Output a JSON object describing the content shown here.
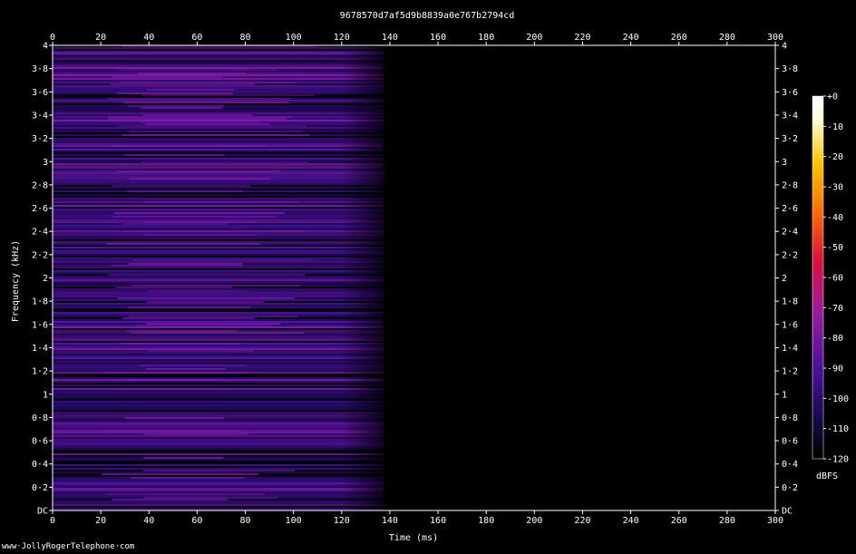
{
  "chart_data": {
    "type": "heatmap",
    "title": "9678570d7af5d9b8839a0e767b2794cd",
    "xlabel": "Time (ms)",
    "ylabel": "Frequency (kHz)",
    "xlim": [
      0,
      300
    ],
    "ylim": [
      0,
      4
    ],
    "x_ticks": [
      0,
      20,
      40,
      60,
      80,
      100,
      120,
      140,
      160,
      180,
      200,
      220,
      240,
      260,
      280,
      300
    ],
    "y_ticks": [
      {
        "value": 0,
        "label": "DC"
      },
      {
        "value": 0.2,
        "label": "0·2"
      },
      {
        "value": 0.4,
        "label": "0·4"
      },
      {
        "value": 0.6,
        "label": "0·6"
      },
      {
        "value": 0.8,
        "label": "0·8"
      },
      {
        "value": 1.0,
        "label": "1"
      },
      {
        "value": 1.2,
        "label": "1·2"
      },
      {
        "value": 1.4,
        "label": "1·4"
      },
      {
        "value": 1.6,
        "label": "1·6"
      },
      {
        "value": 1.8,
        "label": "1·8"
      },
      {
        "value": 2.0,
        "label": "2"
      },
      {
        "value": 2.2,
        "label": "2·2"
      },
      {
        "value": 2.4,
        "label": "2·4"
      },
      {
        "value": 2.6,
        "label": "2·6"
      },
      {
        "value": 2.8,
        "label": "2·8"
      },
      {
        "value": 3.0,
        "label": "3"
      },
      {
        "value": 3.2,
        "label": "3·2"
      },
      {
        "value": 3.4,
        "label": "3·4"
      },
      {
        "value": 3.6,
        "label": "3·6"
      },
      {
        "value": 3.8,
        "label": "3·8"
      },
      {
        "value": 4.0,
        "label": "4"
      }
    ],
    "colorbar": {
      "label": "dBFS",
      "range": [
        -120,
        0
      ],
      "ticks": [
        {
          "value": 0,
          "label": "+0"
        },
        {
          "value": -10,
          "label": "-10"
        },
        {
          "value": -20,
          "label": "-20"
        },
        {
          "value": -30,
          "label": "-30"
        },
        {
          "value": -40,
          "label": "-40"
        },
        {
          "value": -50,
          "label": "-50"
        },
        {
          "value": -60,
          "label": "-60"
        },
        {
          "value": -70,
          "label": "-70"
        },
        {
          "value": -80,
          "label": "-80"
        },
        {
          "value": -90,
          "label": "-90"
        },
        {
          "value": -100,
          "label": "-100"
        },
        {
          "value": -110,
          "label": "-110"
        },
        {
          "value": -120,
          "label": "-120"
        }
      ],
      "colors": [
        "#000000",
        "#1a0a50",
        "#4b10a0",
        "#9a1aa0",
        "#e0103a",
        "#ff6a00",
        "#ffc800",
        "#ffffe0",
        "#ffffff"
      ]
    },
    "energy_regions": [
      {
        "t_start": 0,
        "t_end": 130,
        "level_db": -88,
        "note_free": true
      },
      {
        "t_start": 130,
        "t_end": 142,
        "level_db": -105
      },
      {
        "t_start": 142,
        "t_end": 300,
        "level_db": -118
      }
    ],
    "grid": false,
    "legend": "right"
  },
  "watermark": "www·JollyRogerTelephone·com"
}
